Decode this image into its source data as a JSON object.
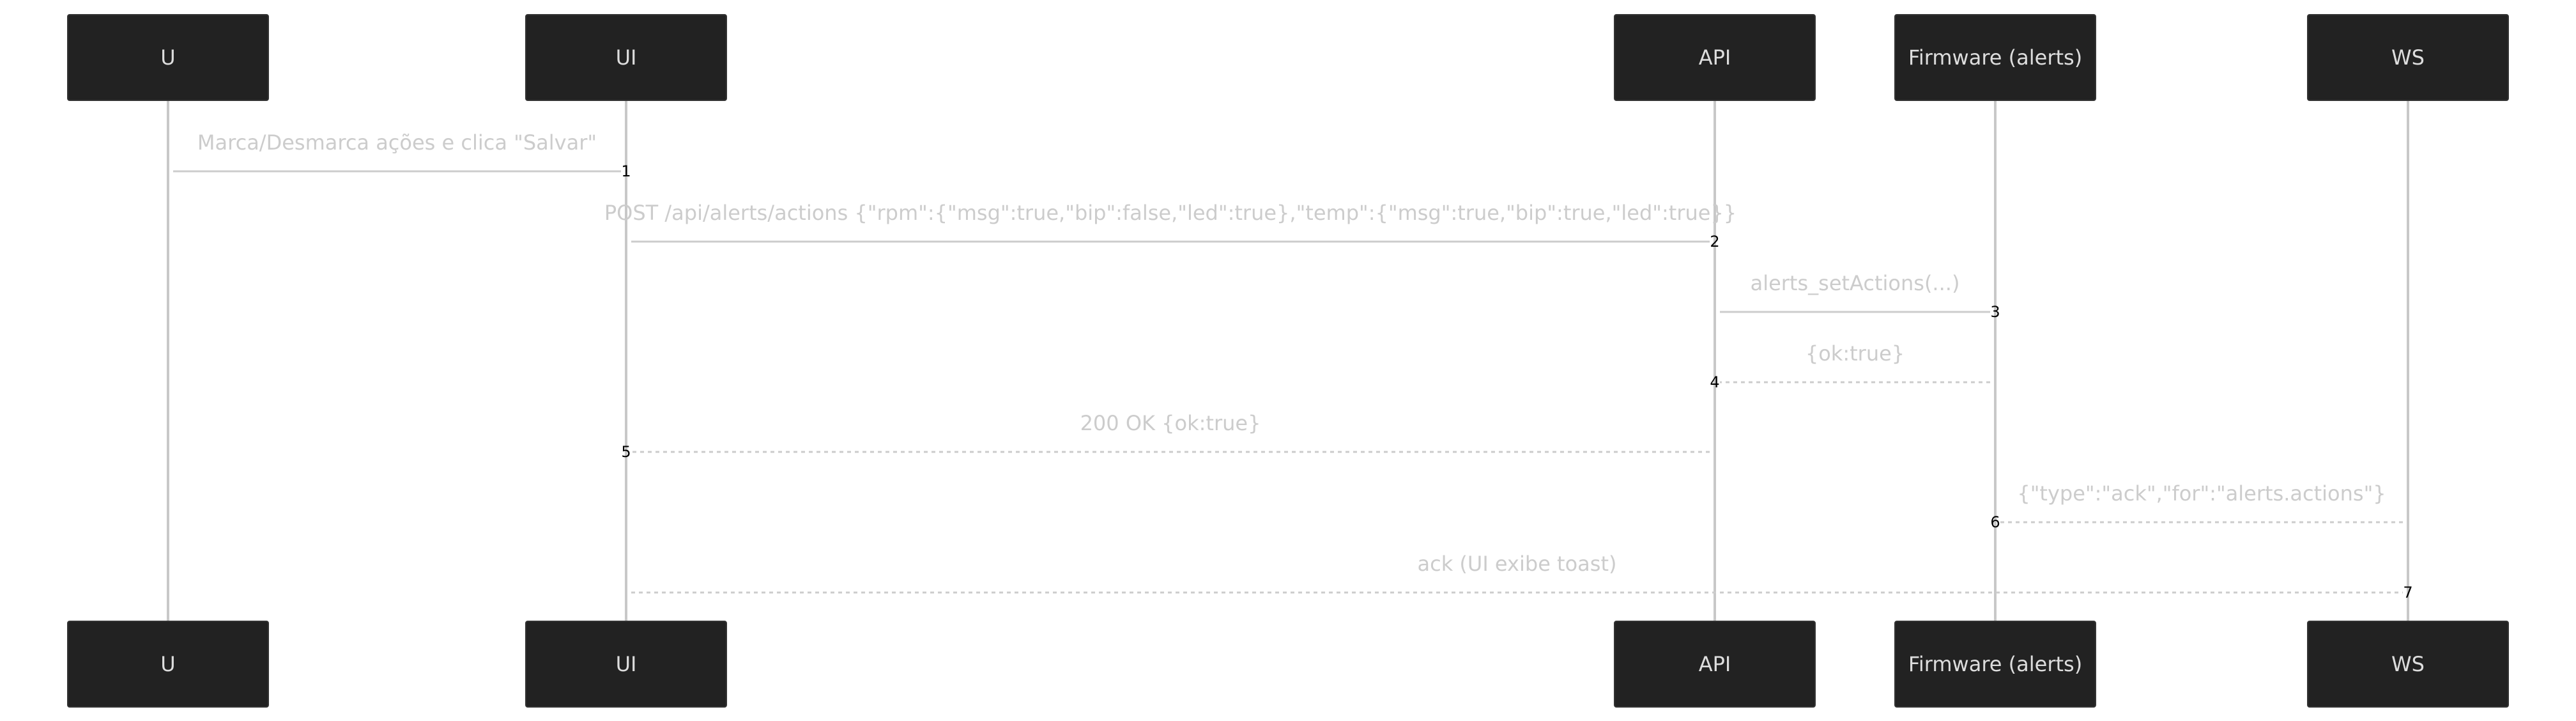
{
  "participants": [
    {
      "id": "U",
      "label": "U"
    },
    {
      "id": "UI",
      "label": "UI"
    },
    {
      "id": "API",
      "label": "API"
    },
    {
      "id": "FW",
      "label": "Firmware (alerts)"
    },
    {
      "id": "WS",
      "label": "WS"
    }
  ],
  "messages": [
    {
      "num": "1",
      "from": "U",
      "to": "UI",
      "text": "Marca/Desmarca ações e clica \"Salvar\"",
      "style": "solid"
    },
    {
      "num": "2",
      "from": "UI",
      "to": "API",
      "text": "POST /api/alerts/actions {\"rpm\":{\"msg\":true,\"bip\":false,\"led\":true},\"temp\":{\"msg\":true,\"bip\":true,\"led\":true}}",
      "style": "solid"
    },
    {
      "num": "3",
      "from": "API",
      "to": "FW",
      "text": "alerts_setActions(...)",
      "style": "solid"
    },
    {
      "num": "4",
      "from": "FW",
      "to": "API",
      "text": "{ok:true}",
      "style": "dashed"
    },
    {
      "num": "5",
      "from": "API",
      "to": "UI",
      "text": "200 OK {ok:true}",
      "style": "dashed"
    },
    {
      "num": "6",
      "from": "WS",
      "to": "FW",
      "text": "{\"type\":\"ack\",\"for\":\"alerts.actions\"}",
      "style": "dashed"
    },
    {
      "num": "7",
      "from": "UI",
      "to": "WS",
      "text": "ack (UI exibe toast)",
      "style": "dashed"
    }
  ]
}
